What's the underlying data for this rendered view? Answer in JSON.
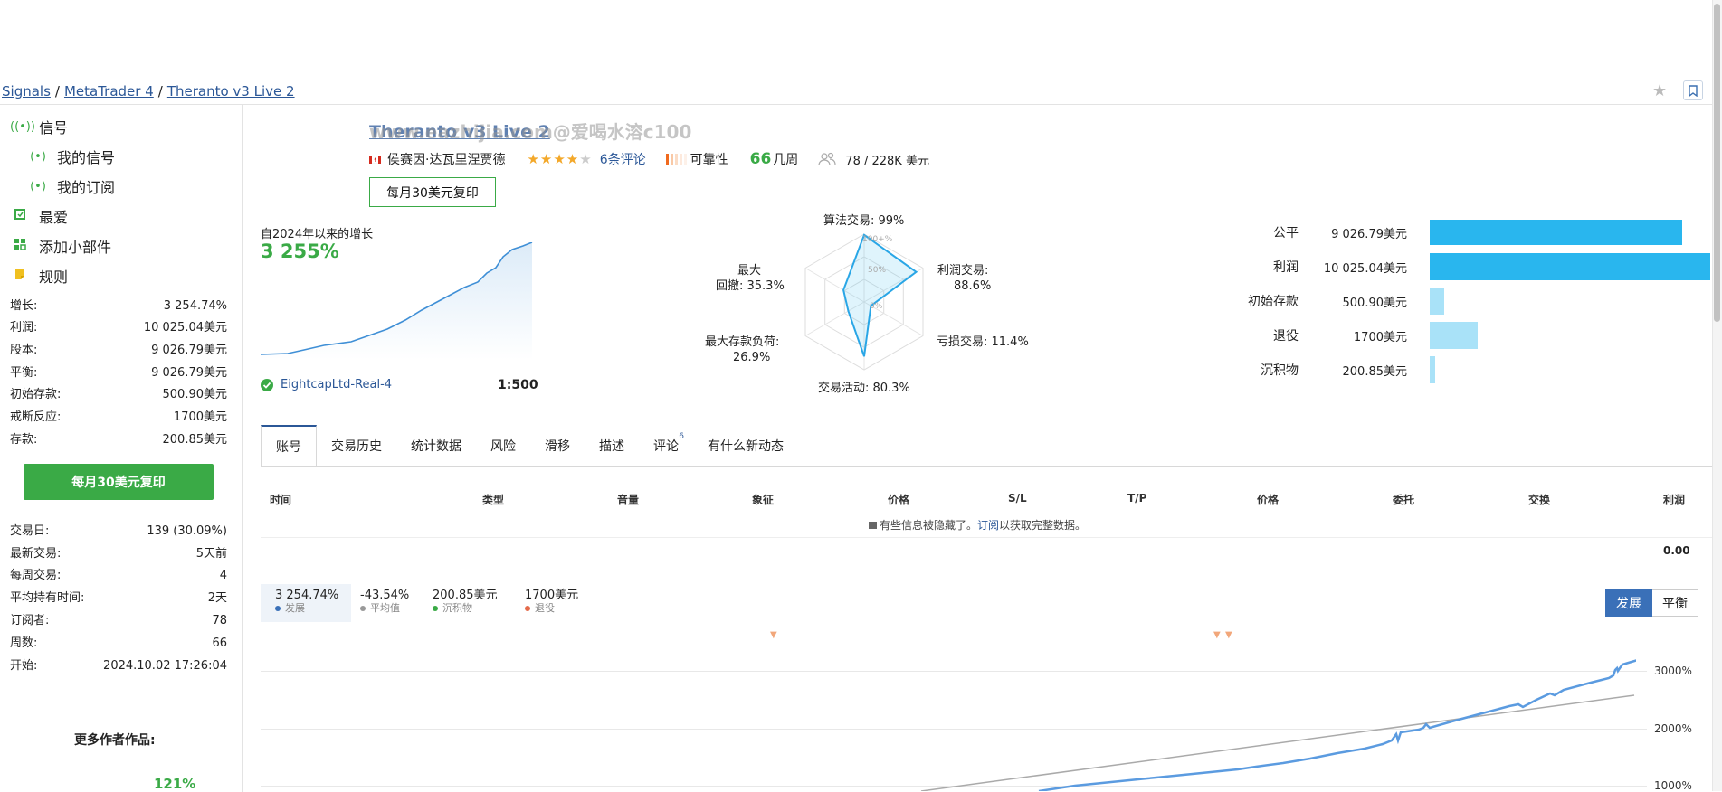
{
  "breadcrumb": {
    "signals": "Signals",
    "platform": "MetaTrader 4",
    "current": "Theranto v3 Live 2",
    "sep": "/"
  },
  "watermark": "www.eazhijia.com@爱喝水溶c100",
  "header": {
    "title": "Theranto v3 Live 2",
    "author": "侯赛因·达瓦里涅贾德",
    "rating_stars": 4,
    "reviews": "6条评论",
    "reliability": "可靠性",
    "weeks_number": "66",
    "weeks_unit": "几周",
    "subscribers": "78 / 228K 美元",
    "copy_button": "每月30美元复印"
  },
  "sidebar": {
    "nav": [
      {
        "label": "信号",
        "icon": "signal-icon"
      },
      {
        "label": "我的信号",
        "icon": "my-signal-icon"
      },
      {
        "label": "我的订阅",
        "icon": "subscriptions-icon"
      },
      {
        "label": "最爱",
        "icon": "favorites-icon"
      },
      {
        "label": "添加小部件",
        "icon": "widget-icon"
      },
      {
        "label": "规则",
        "icon": "rules-icon"
      }
    ],
    "stats1": [
      {
        "k": "增长:",
        "v": "3 254.74%"
      },
      {
        "k": "利润:",
        "v": "10 025.04美元"
      },
      {
        "k": "股本:",
        "v": "9 026.79美元"
      },
      {
        "k": "平衡:",
        "v": "9 026.79美元"
      },
      {
        "k": "初始存款:",
        "v": "500.90美元"
      },
      {
        "k": "戒断反应:",
        "v": "1700美元"
      },
      {
        "k": "存款:",
        "v": "200.85美元"
      }
    ],
    "copy_button": "每月30美元复印",
    "stats2": [
      {
        "k": "交易日:",
        "v": "139 (30.09%)"
      },
      {
        "k": "最新交易:",
        "v": "5天前"
      },
      {
        "k": "每周交易:",
        "v": "4"
      },
      {
        "k": "平均持有时间:",
        "v": "2天"
      },
      {
        "k": "订阅者:",
        "v": "78"
      },
      {
        "k": "周数:",
        "v": "66"
      },
      {
        "k": "开始:",
        "v": "2024.10.02 17:26:04"
      }
    ],
    "more_author": "更多作者作品:",
    "more_author_value": "121%"
  },
  "growth": {
    "label": "自2024年以来的增长",
    "value": "3 255%",
    "broker": "EightcapLtd-Real-4",
    "leverage": "1:500"
  },
  "radar": {
    "ticks": [
      "100+%",
      "50%",
      "0%"
    ],
    "labels": {
      "algo": "算法交易: 99%",
      "profit_l1": "利润交易:",
      "profit_l2": "88.6%",
      "loss": "亏损交易: 11.4%",
      "activity": "交易活动: 80.3%",
      "load_l1": "最大存款负荷:",
      "load_l2": "26.9%",
      "dd_l1": "最大",
      "dd_l2": "回撤: 35.3%"
    },
    "values": {
      "algo": 99,
      "profit": 88.6,
      "loss": 11.4,
      "activity": 80.3,
      "load": 26.9,
      "drawdown": 35.3
    }
  },
  "bars": [
    {
      "label": "公平",
      "value": "9 026.79美元",
      "fraction": 0.9,
      "color": "#29b6ee"
    },
    {
      "label": "利润",
      "value": "10 025.04美元",
      "fraction": 1.0,
      "color": "#29b6ee"
    },
    {
      "label": "初始存款",
      "value": "500.90美元",
      "fraction": 0.05,
      "color": "#a9e2f8"
    },
    {
      "label": "退役",
      "value": "1700美元",
      "fraction": 0.17,
      "color": "#a9e2f8"
    },
    {
      "label": "沉积物",
      "value": "200.85美元",
      "fraction": 0.02,
      "color": "#a9e2f8"
    }
  ],
  "tabs": [
    {
      "label": "账号",
      "active": true
    },
    {
      "label": "交易历史"
    },
    {
      "label": "统计数据"
    },
    {
      "label": "风险"
    },
    {
      "label": "滑移"
    },
    {
      "label": "描述"
    },
    {
      "label": "评论",
      "badge": "6"
    },
    {
      "label": "有什么新动态"
    }
  ],
  "table": {
    "headers": [
      "时间",
      "类型",
      "音量",
      "象征",
      "价格",
      "S/L",
      "T/P",
      "价格",
      "委托",
      "交换",
      "利润"
    ],
    "hidden_note_prefix": "有些信息被隐藏了。",
    "hidden_note_link": "订阅",
    "hidden_note_suffix": "以获取完整数据。",
    "total": "0.00"
  },
  "chart_legend": [
    {
      "value": "3 254.74%",
      "label": "发展",
      "color": "#3a70b8"
    },
    {
      "value": "-43.54%",
      "label": "平均值",
      "color": "#999999"
    },
    {
      "value": "200.85美元",
      "label": "沉积物",
      "color": "#3aaa46"
    },
    {
      "value": "1700美元",
      "label": "退役",
      "color": "#e46a4a"
    }
  ],
  "chart_toggle": {
    "growth": "发展",
    "balance": "平衡"
  },
  "chart_data": {
    "type": "line",
    "y_ticks": [
      "3000%",
      "2000%",
      "1000%"
    ],
    "series": [
      {
        "name": "发展",
        "color": "#5b9be0"
      },
      {
        "name": "平均值",
        "color": "#aaaaaa"
      }
    ]
  }
}
